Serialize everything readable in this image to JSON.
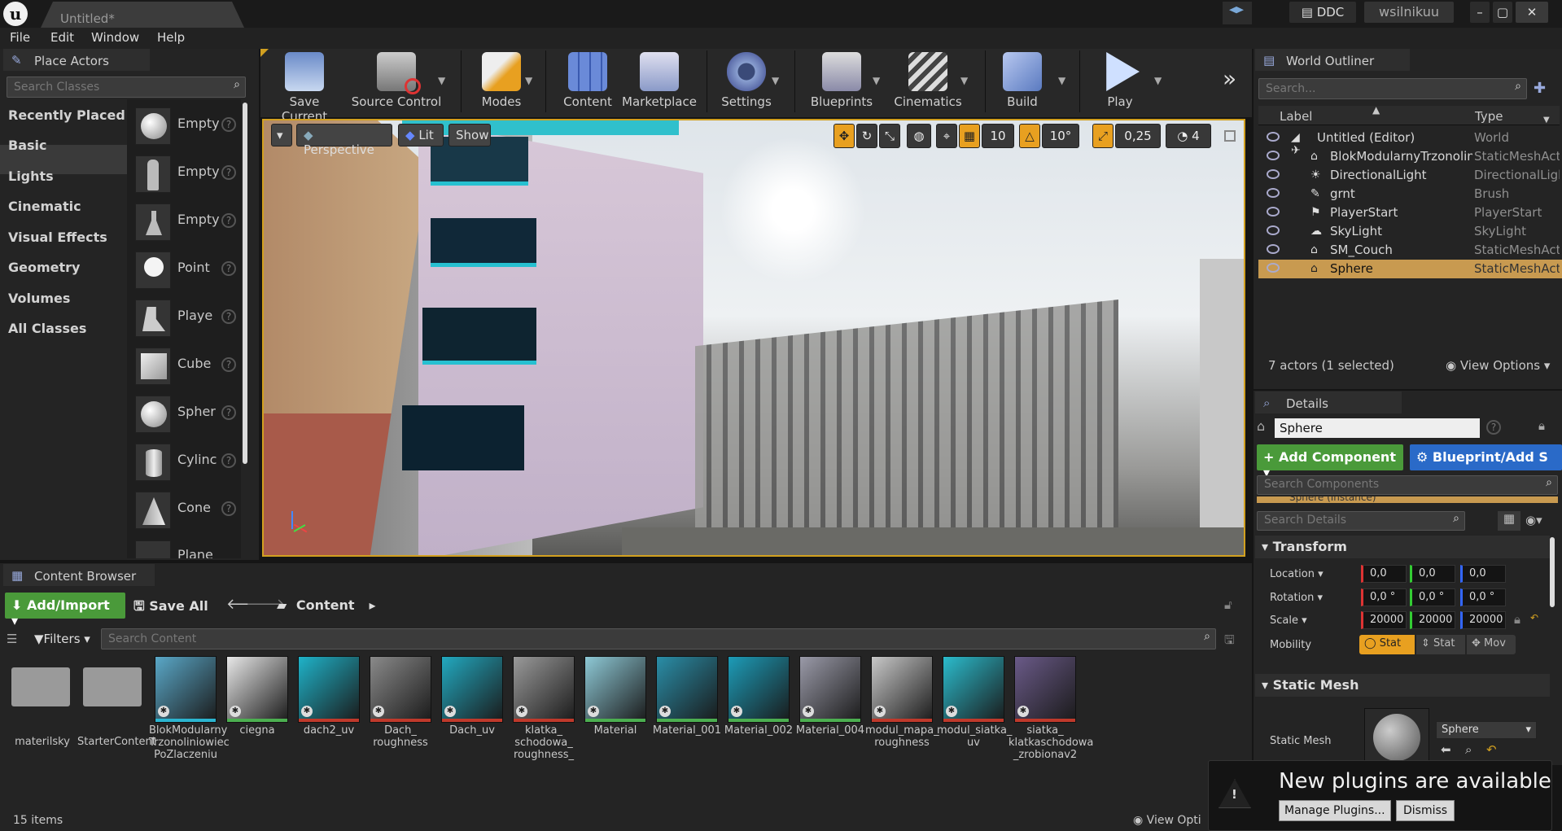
{
  "window": {
    "tab_title": "Untitled*",
    "ddc_label": "DDC",
    "user": "wsilnikuu"
  },
  "menu": [
    "File",
    "Edit",
    "Window",
    "Help"
  ],
  "place_actors": {
    "tab": "Place Actors",
    "search_placeholder": "Search Classes",
    "categories": [
      "Recently Placed",
      "Basic",
      "Lights",
      "Cinematic",
      "Visual Effects",
      "Geometry",
      "Volumes",
      "All Classes"
    ],
    "selected_category": "Basic",
    "items": [
      "Empty",
      "Empty",
      "Empty",
      "Point",
      "Playe",
      "Cube",
      "Spher",
      "Cylinc",
      "Cone",
      "Plane"
    ]
  },
  "toolbar": {
    "buttons": [
      "Save Current",
      "Source Control",
      "Modes",
      "Content",
      "Marketplace",
      "Settings",
      "Blueprints",
      "Cinematics",
      "Build",
      "Play"
    ],
    "more": "»"
  },
  "viewport": {
    "perspective": "Perspective",
    "lit": "Lit",
    "show": "Show",
    "grid_snap": "10",
    "rot_snap": "10°",
    "scale_snap": "0,25",
    "cam_speed": "4"
  },
  "world_outliner": {
    "tab": "World Outliner",
    "search_placeholder": "Search...",
    "col_label": "Label",
    "col_type": "Type",
    "rows": [
      {
        "label": "Untitled (Editor)",
        "type": "World"
      },
      {
        "label": "BlokModularnyTrzonolinio",
        "type": "StaticMeshAct"
      },
      {
        "label": "DirectionalLight",
        "type": "DirectionalLigl"
      },
      {
        "label": "grnt",
        "type": "Brush"
      },
      {
        "label": "PlayerStart",
        "type": "PlayerStart"
      },
      {
        "label": "SkyLight",
        "type": "SkyLight"
      },
      {
        "label": "SM_Couch",
        "type": "StaticMeshAct"
      },
      {
        "label": "Sphere",
        "type": "StaticMeshAct"
      }
    ],
    "status": "7 actors (1 selected)",
    "view_options": "View Options"
  },
  "details": {
    "tab": "Details",
    "name": "Sphere",
    "add_component": "+ Add Component",
    "blueprint": "Blueprint/Add S",
    "search_components": "Search Components",
    "component_row": "Sphere (Instance)",
    "search_details": "Search Details",
    "transform": "Transform",
    "location_label": "Location",
    "location": [
      "0,0",
      "0,0",
      "0,0"
    ],
    "rotation_label": "Rotation",
    "rotation": [
      "0,0 °",
      "0,0 °",
      "0,0 °"
    ],
    "scale_label": "Scale",
    "scale": [
      "20000",
      "20000",
      "20000"
    ],
    "mobility_label": "Mobility",
    "mobility": [
      "Stat",
      "Stat",
      "Mov"
    ],
    "static_mesh_section": "Static Mesh",
    "static_mesh_label": "Static Mesh",
    "static_mesh_value": "Sphere"
  },
  "content_browser": {
    "tab": "Content Browser",
    "add_import": "Add/Import",
    "save_all": "Save All",
    "path": "Content",
    "filters": "Filters",
    "search_placeholder": "Search Content",
    "assets": [
      {
        "name": "materilsky",
        "color": "#9a9a9a",
        "line": ""
      },
      {
        "name": "StarterContent",
        "color": "#9a9a9a",
        "line": ""
      },
      {
        "name": "BlokModularny Trzonoliniowiec PoZlaczeniu",
        "color": "#5aa8c8",
        "line": "#2bb5d0"
      },
      {
        "name": "ciegna",
        "color": "#e8e8e8",
        "line": "#4caf50"
      },
      {
        "name": "dach2_uv",
        "color": "#1fb3c9",
        "line": "#c0392b"
      },
      {
        "name": "Dach_ roughness",
        "color": "#8a8a8a",
        "line": "#c0392b"
      },
      {
        "name": "Dach_uv",
        "color": "#22a9c0",
        "line": "#c0392b"
      },
      {
        "name": "klatka_ schodowa_ roughness_",
        "color": "#9a9a9a",
        "line": "#c0392b"
      },
      {
        "name": "Material",
        "color": "#8ec9d6",
        "line": "#4caf50"
      },
      {
        "name": "Material_001",
        "color": "#2a8ea8",
        "line": "#4caf50"
      },
      {
        "name": "Material_002",
        "color": "#1c9cb8",
        "line": "#4caf50"
      },
      {
        "name": "Material_004",
        "color": "#9a9aa8",
        "line": "#4caf50"
      },
      {
        "name": "modul_mapa_ roughness",
        "color": "#c8c8c8",
        "line": "#c0392b"
      },
      {
        "name": "modul_siatka_ uv",
        "color": "#2bbccd",
        "line": "#c0392b"
      },
      {
        "name": "siatka_ klatkaschodowa _zrobionav2",
        "color": "#6a5a88",
        "line": "#c0392b"
      }
    ],
    "item_count": "15 items",
    "view_options": "View Opti"
  },
  "notification": {
    "title": "New plugins are available",
    "manage": "Manage Plugins...",
    "dismiss": "Dismiss"
  }
}
